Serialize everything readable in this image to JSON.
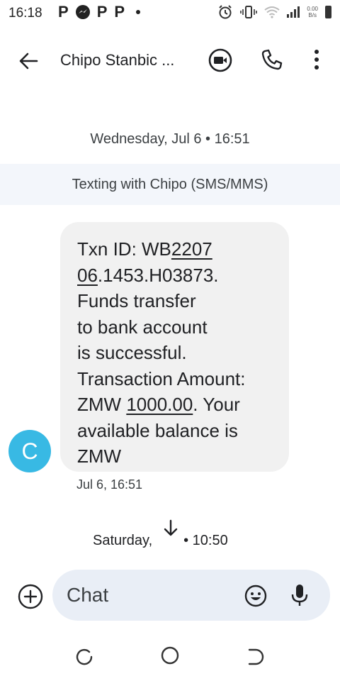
{
  "status_bar": {
    "time": "16:18",
    "notification_icons": [
      "p-icon",
      "messenger-icon",
      "p-icon",
      "p-icon",
      "dot-icon"
    ],
    "net_speed_value": "0.00",
    "net_speed_unit": "B/s",
    "system_icons": [
      "alarm-icon",
      "vibrate-icon",
      "wifi-icon",
      "signal-icon",
      "battery-icon"
    ]
  },
  "app_bar": {
    "title": "Chipo Stanbic ...",
    "actions": [
      "video-call-icon",
      "phone-icon",
      "more-vert-icon"
    ]
  },
  "conversation": {
    "date_header": "Wednesday, Jul 6 • 16:51",
    "banner": "Texting with Chipo (SMS/MMS)",
    "message": {
      "avatar_letter": "C",
      "avatar_color": "#38b9e4",
      "bubble_color": "#f1f1f1",
      "lines": {
        "l1a": "Txn ID: WB",
        "l1b": "2207",
        "l2a": "06",
        "l2b": ".1453.H03873.",
        "l3": "Funds transfer",
        "l4": "to bank account",
        "l5": "is successful.",
        "l6": "Transaction Amount:",
        "l7a": "ZMW ",
        "l7b": "1000.00",
        "l7c": ". Your",
        "l8": "available balance is",
        "l9": "ZMW"
      },
      "timestamp": "Jul 6, 16:51"
    },
    "next_date_header": {
      "left": "Saturday,",
      "right": "• 10:50"
    }
  },
  "compose": {
    "placeholder": "Chat",
    "background": "#e9eef6"
  },
  "nav_bar": [
    "recents-icon",
    "home-icon",
    "back-icon"
  ]
}
